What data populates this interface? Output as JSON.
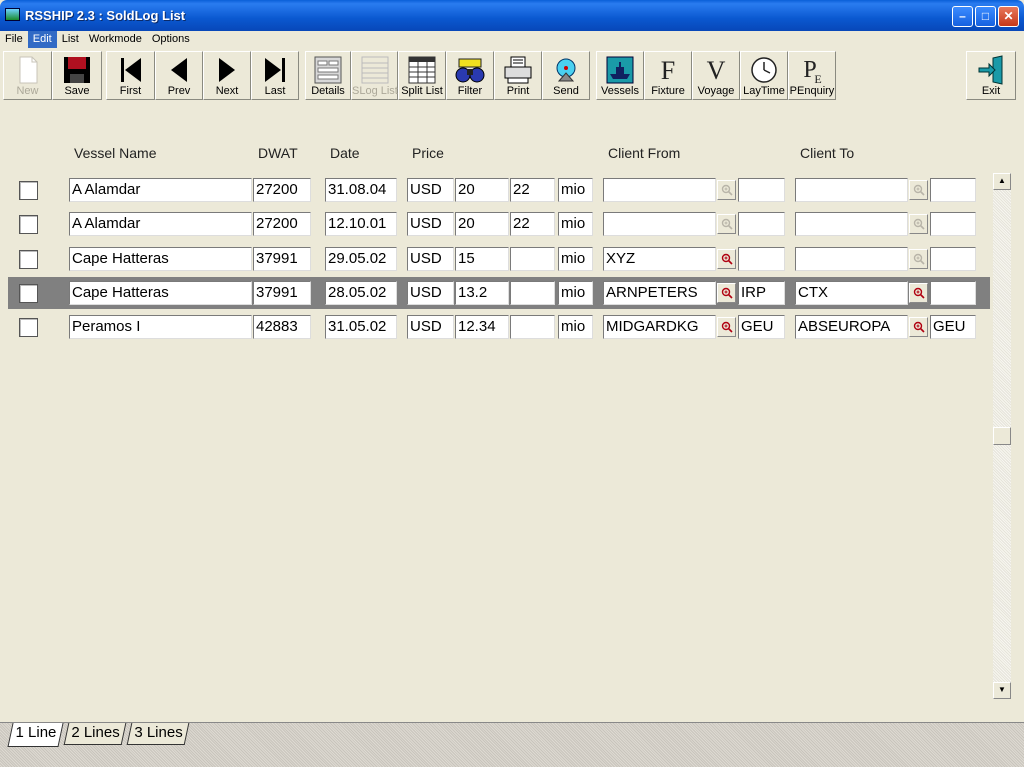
{
  "window": {
    "title": "RSSHIP 2.3 : SoldLog List"
  },
  "menu": [
    "File",
    "Edit",
    "List",
    "Workmode",
    "Options"
  ],
  "toolbar": {
    "new": "New",
    "save": "Save",
    "first": "First",
    "prev": "Prev",
    "next": "Next",
    "last": "Last",
    "details": "Details",
    "slog_list": "SLog List",
    "split_list": "Split List",
    "filter": "Filter",
    "print": "Print",
    "send": "Send",
    "vessels": "Vessels",
    "fixture": "Fixture",
    "voyage": "Voyage",
    "laytime": "LayTime",
    "penquiry": "PEnquiry",
    "exit": "Exit"
  },
  "columns": {
    "vessel_name": "Vessel Name",
    "dwat": "DWAT",
    "date": "Date",
    "price": "Price",
    "client_from": "Client From",
    "client_to": "Client To"
  },
  "rows": [
    {
      "vessel": "A Alamdar",
      "dwat": "27200",
      "date": "31.08.04",
      "currency": "USD",
      "price_from": "20",
      "price_to": "22",
      "unit": "mio",
      "client_from": "",
      "client_from_code": "",
      "client_to": "",
      "client_to_code": "",
      "lookup_from_enabled": false,
      "lookup_to_enabled": false
    },
    {
      "vessel": "A Alamdar",
      "dwat": "27200",
      "date": "12.10.01",
      "currency": "USD",
      "price_from": "20",
      "price_to": "22",
      "unit": "mio",
      "client_from": "",
      "client_from_code": "",
      "client_to": "",
      "client_to_code": "",
      "lookup_from_enabled": false,
      "lookup_to_enabled": false
    },
    {
      "vessel": "Cape Hatteras",
      "dwat": "37991",
      "date": "29.05.02",
      "currency": "USD",
      "price_from": "15",
      "price_to": "",
      "unit": "mio",
      "client_from": "XYZ",
      "client_from_code": "",
      "client_to": "",
      "client_to_code": "",
      "lookup_from_enabled": true,
      "lookup_to_enabled": false
    },
    {
      "vessel": "Cape Hatteras",
      "dwat": "37991",
      "date": "28.05.02",
      "currency": "USD",
      "price_from": "13.2",
      "price_to": "",
      "unit": "mio",
      "client_from": "ARNPETERS",
      "client_from_code": "IRP",
      "client_to": "CTX",
      "client_to_code": "",
      "lookup_from_enabled": true,
      "lookup_to_enabled": true
    },
    {
      "vessel": "Peramos I",
      "dwat": "42883",
      "date": "31.05.02",
      "currency": "USD",
      "price_from": "12.34",
      "price_to": "",
      "unit": "mio",
      "client_from": "MIDGARDKG",
      "client_from_code": "GEU",
      "client_to": "ABSEUROPA",
      "client_to_code": "GEU",
      "lookup_from_enabled": true,
      "lookup_to_enabled": true
    }
  ],
  "selected_row": 3,
  "tabs": [
    "1 Line",
    "2 Lines",
    "3 Lines"
  ],
  "active_tab": 0
}
